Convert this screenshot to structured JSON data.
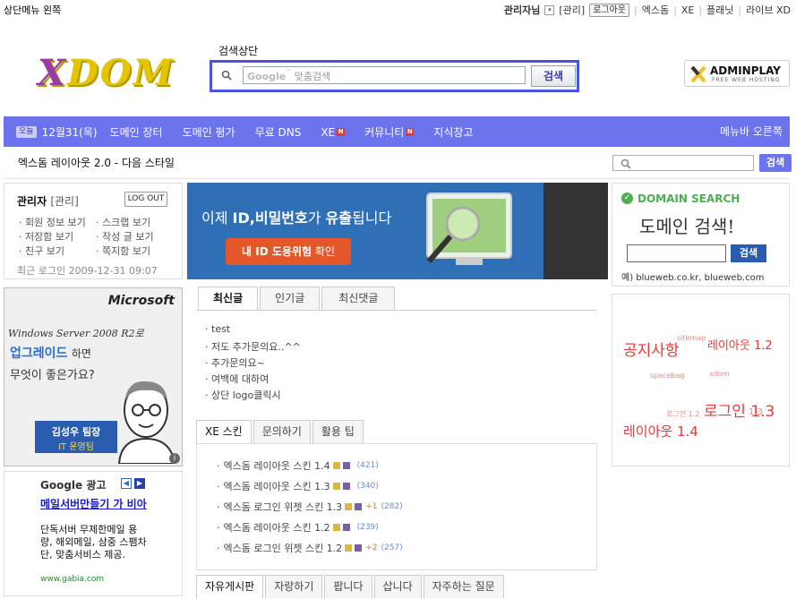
{
  "top": {
    "left_label": "상단메뉴 왼쪽",
    "user": "관리자님",
    "admin": "[관리]",
    "logout": "로그아웃",
    "links": [
      "엑스돔",
      "XE",
      "플래닛",
      "라이브 XD"
    ]
  },
  "header": {
    "logo": {
      "part1": "X",
      "part2": "DOM"
    },
    "search_title": "검색상단",
    "search_placeholder": "맞춤검색",
    "google_label": "Google",
    "search_button": "검색",
    "ad_brand": "ADMINPLAY",
    "ad_sub": "FREE WEB HOSTING"
  },
  "nav": {
    "today": "오늘",
    "date": "12월31(목)",
    "items": [
      "도메인 장터",
      "도메인 평가",
      "무료 DNS",
      "XE",
      "커뮤니티",
      "지식창고"
    ],
    "badge": "N",
    "right": "메뉴바 오른쪽"
  },
  "sub": {
    "title": "엑스돔 레이아웃 2.0 - 다음 스타일",
    "search_button": "검색"
  },
  "login": {
    "name": "관리자",
    "admin": "[관리]",
    "logout": "LOG OUT",
    "links": [
      "회원 정보 보기",
      "스크랩 보기",
      "저장함 보기",
      "작성 글 보기",
      "친구 보기",
      "쪽지함 보기"
    ],
    "last_login": "최근 로그인 2009-12-31 09:07"
  },
  "ms_ad": {
    "brand": "Microsoft",
    "line1": "Windows Server 2008 R2로",
    "line2a": "업그레이드",
    "line2b": "하면",
    "line3": "무엇이 좋은가요?",
    "person": "김성우 팀장",
    "team": "IT 운영팀"
  },
  "google_ad": {
    "title": "Google 광고",
    "headline": "메일서버만들기 가 비아",
    "body": "단독서버 무제한메일 용량, 해외메일, 삼중 스팸차단, 맞춤서비스 제공.",
    "url": "www.gabia.com"
  },
  "banner": {
    "text_a": "이제 ",
    "text_b": "ID,비밀번호",
    "text_c": "가 ",
    "text_d": "유출",
    "text_e": "됩니다",
    "button_a": "내 ID 도용위험",
    "button_b": " 확인"
  },
  "tabs1": {
    "items": [
      "최신글",
      "인기글",
      "최신댓글"
    ],
    "posts": [
      "test",
      "저도 추가문의요..^^",
      "추가문의요~",
      "여백에 대하여",
      "상단 logo클릭시"
    ]
  },
  "tabs2": {
    "items": [
      "XE 스킨",
      "문의하기",
      "활용 팁"
    ],
    "rows": [
      {
        "title": "엑스돔 레이아웃 스킨 1.4",
        "plus": "",
        "count": "(421)"
      },
      {
        "title": "엑스돔 레이아웃 스킨 1.3",
        "plus": "",
        "count": "(340)"
      },
      {
        "title": "엑스돔 로그인 위젯 스킨 1.3",
        "plus": "+1",
        "count": "(282)"
      },
      {
        "title": "엑스돔 레이아웃 스킨 1.2",
        "plus": "",
        "count": "(239)"
      },
      {
        "title": "엑스돔 로그인 위젯 스킨 1.2",
        "plus": "+2",
        "count": "(257)"
      }
    ]
  },
  "tabs3": {
    "items": [
      "자유게시판",
      "자랑하기",
      "팝니다",
      "삽니다",
      "자주하는 질문"
    ]
  },
  "domain": {
    "title": "DOMAIN SEARCH",
    "subtitle": "도메인 검색!",
    "button": "검색",
    "example": "예) blueweb.co.kr, blueweb.com"
  },
  "tags": {
    "notice": "공지사항",
    "sitemap": "sitemap",
    "layout12": "레이아웃 1.2",
    "spacebag": "spacebag",
    "xdom": "xdom",
    "login12": "로그인 1.2",
    "login13": "로그인 1.3",
    "small13": "1.3",
    "layout14": "레이아웃 1.4"
  },
  "colors": {
    "accent": "#6b73ed",
    "tag_red": "#e8393b",
    "tag_pink": "#f08a8a"
  }
}
